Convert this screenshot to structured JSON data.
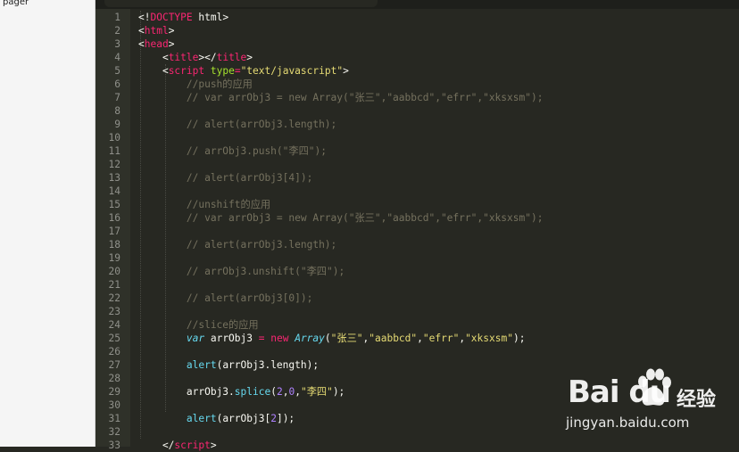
{
  "sidebar": {
    "file_label": "pager"
  },
  "lines": [
    {
      "n": "1",
      "segs": [
        [
          "",
          "<!"
        ],
        [
          "t",
          "DOCTYPE"
        ],
        [
          "",
          " html>"
        ]
      ]
    },
    {
      "n": "2",
      "segs": [
        [
          "",
          "<"
        ],
        [
          "t",
          "html"
        ],
        [
          "",
          ">"
        ]
      ]
    },
    {
      "n": "3",
      "segs": [
        [
          "",
          "<"
        ],
        [
          "t",
          "head"
        ],
        [
          "",
          ">"
        ]
      ]
    },
    {
      "n": "4",
      "segs": [
        [
          "",
          "    <"
        ],
        [
          "t",
          "title"
        ],
        [
          "",
          "></"
        ],
        [
          "t",
          "title"
        ],
        [
          "",
          ">"
        ]
      ]
    },
    {
      "n": "5",
      "segs": [
        [
          "",
          "    <"
        ],
        [
          "t",
          "script"
        ],
        [
          "",
          " "
        ],
        [
          "a",
          "type"
        ],
        [
          "t",
          "="
        ],
        [
          "s",
          "\"text/javascript\""
        ],
        [
          "",
          ">"
        ]
      ]
    },
    {
      "n": "6",
      "segs": [
        [
          "c",
          "        //push的应用"
        ]
      ]
    },
    {
      "n": "7",
      "segs": [
        [
          "c",
          "        // var arrObj3 = new Array(\"张三\",\"aabbcd\",\"efrr\",\"xksxsm\");"
        ]
      ]
    },
    {
      "n": "8",
      "segs": []
    },
    {
      "n": "9",
      "segs": [
        [
          "c",
          "        // alert(arrObj3.length);"
        ]
      ]
    },
    {
      "n": "10",
      "segs": []
    },
    {
      "n": "11",
      "segs": [
        [
          "c",
          "        // arrObj3.push(\"李四\");"
        ]
      ]
    },
    {
      "n": "12",
      "segs": []
    },
    {
      "n": "13",
      "segs": [
        [
          "c",
          "        // alert(arrObj3[4]);"
        ]
      ]
    },
    {
      "n": "14",
      "segs": []
    },
    {
      "n": "15",
      "segs": [
        [
          "c",
          "        //unshift的应用"
        ]
      ]
    },
    {
      "n": "16",
      "segs": [
        [
          "c",
          "        // var arrObj3 = new Array(\"张三\",\"aabbcd\",\"efrr\",\"xksxsm\");"
        ]
      ]
    },
    {
      "n": "17",
      "segs": []
    },
    {
      "n": "18",
      "segs": [
        [
          "c",
          "        // alert(arrObj3.length);"
        ]
      ]
    },
    {
      "n": "19",
      "segs": []
    },
    {
      "n": "20",
      "segs": [
        [
          "c",
          "        // arrObj3.unshift(\"李四\");"
        ]
      ]
    },
    {
      "n": "21",
      "segs": []
    },
    {
      "n": "22",
      "segs": [
        [
          "c",
          "        // alert(arrObj3[0]);"
        ]
      ]
    },
    {
      "n": "23",
      "segs": []
    },
    {
      "n": "24",
      "segs": [
        [
          "c",
          "        //slice的应用"
        ]
      ]
    },
    {
      "n": "25",
      "segs": [
        [
          "",
          "        "
        ],
        [
          "k",
          "var"
        ],
        [
          "",
          " arrObj3 "
        ],
        [
          "t",
          "="
        ],
        [
          "",
          " "
        ],
        [
          "t",
          "new"
        ],
        [
          "",
          " "
        ],
        [
          "k",
          "Array"
        ],
        [
          "",
          "("
        ],
        [
          "s",
          "\"张三\""
        ],
        [
          "",
          ","
        ],
        [
          "s",
          "\"aabbcd\""
        ],
        [
          "",
          ","
        ],
        [
          "s",
          "\"efrr\""
        ],
        [
          "",
          ","
        ],
        [
          "s",
          "\"xksxsm\""
        ],
        [
          "",
          ");"
        ]
      ]
    },
    {
      "n": "26",
      "segs": []
    },
    {
      "n": "27",
      "segs": [
        [
          "",
          "        "
        ],
        [
          "f",
          "alert"
        ],
        [
          "",
          "(arrObj3.length);"
        ]
      ]
    },
    {
      "n": "28",
      "segs": []
    },
    {
      "n": "29",
      "segs": [
        [
          "",
          "        arrObj3."
        ],
        [
          "f",
          "splice"
        ],
        [
          "",
          "("
        ],
        [
          "n",
          "2"
        ],
        [
          "",
          ","
        ],
        [
          "n",
          "0"
        ],
        [
          "",
          ","
        ],
        [
          "s",
          "\"李四\""
        ],
        [
          "",
          ");"
        ]
      ]
    },
    {
      "n": "30",
      "segs": []
    },
    {
      "n": "31",
      "segs": [
        [
          "",
          "        "
        ],
        [
          "f",
          "alert"
        ],
        [
          "",
          "(arrObj3["
        ],
        [
          "n",
          "2"
        ],
        [
          "",
          "]);"
        ]
      ]
    },
    {
      "n": "32",
      "segs": []
    },
    {
      "n": "33",
      "segs": [
        [
          "",
          "    </"
        ],
        [
          "t",
          "script"
        ],
        [
          "",
          ">"
        ]
      ]
    }
  ],
  "watermark": {
    "brand_text": "Bai du",
    "cn_text": "经验",
    "url_text": "jingyan.baidu.com"
  }
}
